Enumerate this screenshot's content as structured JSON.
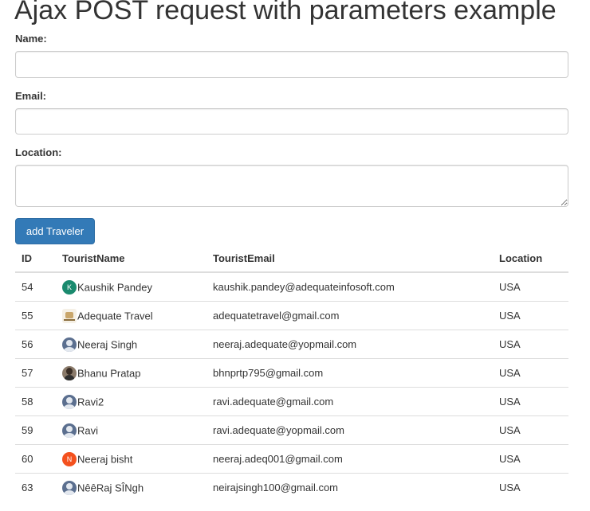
{
  "page": {
    "title": "Ajax POST request with parameters example"
  },
  "form": {
    "name_label": "Name:",
    "name_value": "",
    "email_label": "Email:",
    "email_value": "",
    "location_label": "Location:",
    "location_value": "",
    "submit_label": "add Traveler"
  },
  "table": {
    "headers": {
      "id": "ID",
      "name": "TouristName",
      "email": "TouristEmail",
      "location": "Location"
    },
    "rows": [
      {
        "id": "54",
        "name": "Kaushik Pandey",
        "email": "kaushik.pandey@adequateinfosoft.com",
        "location": "USA",
        "avatar": {
          "type": "initial",
          "letter": "K",
          "color": "#1a8a6e",
          "icon": "avatar-initial-icon"
        }
      },
      {
        "id": "55",
        "name": "Adequate Travel",
        "email": "adequatetravel@gmail.com",
        "location": "USA",
        "avatar": {
          "type": "logo",
          "icon": "avatar-logo-icon"
        }
      },
      {
        "id": "56",
        "name": "Neeraj Singh",
        "email": "neeraj.adequate@yopmail.com",
        "location": "USA",
        "avatar": {
          "type": "person",
          "icon": "avatar-person-icon"
        }
      },
      {
        "id": "57",
        "name": "Bhanu Pratap",
        "email": "bhnprtp795@gmail.com",
        "location": "USA",
        "avatar": {
          "type": "photo",
          "icon": "avatar-photo-icon"
        }
      },
      {
        "id": "58",
        "name": "Ravi2",
        "email": "ravi.adequate@gmail.com",
        "location": "USA",
        "avatar": {
          "type": "person",
          "icon": "avatar-person-icon"
        }
      },
      {
        "id": "59",
        "name": "Ravi",
        "email": "ravi.adequate@yopmail.com",
        "location": "USA",
        "avatar": {
          "type": "person",
          "icon": "avatar-person-icon"
        }
      },
      {
        "id": "60",
        "name": "Neeraj bisht",
        "email": "neeraj.adeq001@gmail.com",
        "location": "USA",
        "avatar": {
          "type": "initial",
          "letter": "N",
          "color": "#f4511e",
          "icon": "avatar-initial-icon"
        }
      },
      {
        "id": "63",
        "name": "NêêRaj SÎNgh",
        "email": "neirajsingh100@gmail.com",
        "location": "USA",
        "avatar": {
          "type": "person",
          "icon": "avatar-person-icon"
        }
      }
    ]
  },
  "colors": {
    "button_bg": "#337ab7",
    "button_border": "#2e6da4",
    "table_border": "#dddddd",
    "input_border": "#cccccc"
  }
}
